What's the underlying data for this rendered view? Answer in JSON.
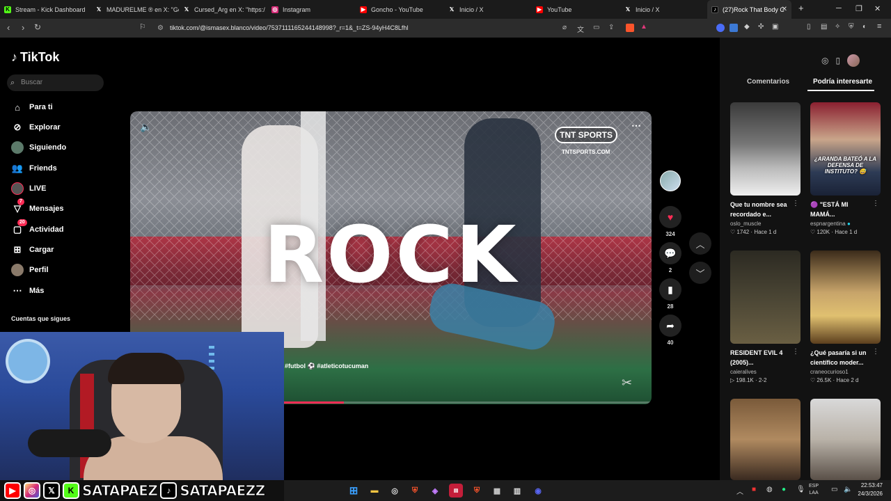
{
  "browser": {
    "tabs": [
      {
        "label": "Stream - Kick Dashboard",
        "icon": "kick-icon",
        "color": "#53fc18"
      },
      {
        "label": "MADURELME ® en X: \"Go",
        "icon": "x-icon",
        "color": "#000000"
      },
      {
        "label": "Cursed_Arg en X: \"https://",
        "icon": "x-icon",
        "color": "#000000"
      },
      {
        "label": "Instagram",
        "icon": "instagram-icon",
        "color": "#d62976"
      },
      {
        "label": "Goncho - YouTube",
        "icon": "youtube-icon",
        "color": "#ff0000"
      },
      {
        "label": "Inicio / X",
        "icon": "x-icon",
        "color": "#000000"
      },
      {
        "label": "YouTube",
        "icon": "youtube-icon",
        "color": "#ff0000"
      },
      {
        "label": "Inicio / X",
        "icon": "x-icon",
        "color": "#000000"
      },
      {
        "label": "(27)Rock That Body C",
        "icon": "tiktok-icon",
        "color": "#000000"
      }
    ],
    "new_tab": "+",
    "url": "tiktok.com/@ismasex.blanco/video/7537111165244148998?_r=1&_t=ZS-94yH4C8Lfhl"
  },
  "sidebar": {
    "logo": "TikTok",
    "search_placeholder": "Buscar",
    "items": [
      {
        "label": "Para ti",
        "icon": "home-icon"
      },
      {
        "label": "Explorar",
        "icon": "compass-icon"
      },
      {
        "label": "Siguiendo",
        "icon": "following-avatar-icon"
      },
      {
        "label": "Friends",
        "icon": "friends-icon"
      },
      {
        "label": "LIVE",
        "icon": "live-icon"
      },
      {
        "label": "Mensajes",
        "icon": "messages-icon",
        "badge": "7"
      },
      {
        "label": "Actividad",
        "icon": "activity-icon",
        "badge": "20"
      },
      {
        "label": "Cargar",
        "icon": "upload-icon"
      },
      {
        "label": "Perfil",
        "icon": "profile-icon"
      },
      {
        "label": "Más",
        "icon": "more-icon"
      }
    ],
    "following_title": "Cuentas que sigues"
  },
  "video": {
    "overlay_text": "ROCK",
    "tnt_logo": "TNT SPORTS",
    "tnt_sub": "TNTSPORTS.COM",
    "hashtags": "#futbol ⚽ #atleticotucuman",
    "progress": 0.41,
    "accent": "#fe2c55"
  },
  "actions": {
    "likes": "324",
    "comments": "2",
    "saves": "28",
    "shares": "40"
  },
  "right_panel": {
    "tab_comments": "Comentarios",
    "tab_suggest": "Podría interesarte",
    "cards": [
      {
        "title": "Que tu nombre sea recordado e...",
        "user": "oslo_muscle",
        "likes": "1742",
        "time": "Hace 1 d",
        "caption": ""
      },
      {
        "title": "🟣 \"ESTÁ MI MAMÁ...",
        "user": "espnargentina",
        "likes": "120K",
        "time": "Hace 1 d",
        "caption": "¿ARANDA BATEÓ A LA DEFENSA DE INSTITUTO? 😅"
      },
      {
        "title": "RESIDENT EVIL 4 (2005)...",
        "user": "caieralives",
        "likes": "198.1K",
        "time": "2-2",
        "caption": ""
      },
      {
        "title": "¿Qué pasaría si un científico moder...",
        "user": "craneocurioso1",
        "likes": "26.5K",
        "time": "Hace 2 d",
        "caption": ""
      },
      {
        "title": "",
        "user": "",
        "likes": "",
        "time": "",
        "caption": ""
      },
      {
        "title": "",
        "user": "",
        "likes": "",
        "time": "",
        "caption": ""
      }
    ]
  },
  "stream": {
    "handle_kick": "SATAPAEZ",
    "handle_tiktok": "SATAPAEZZ"
  },
  "taskbar": {
    "lang": "ESP",
    "lang2": "LAA",
    "time": "22:53:47",
    "date": "24/3/2026"
  }
}
